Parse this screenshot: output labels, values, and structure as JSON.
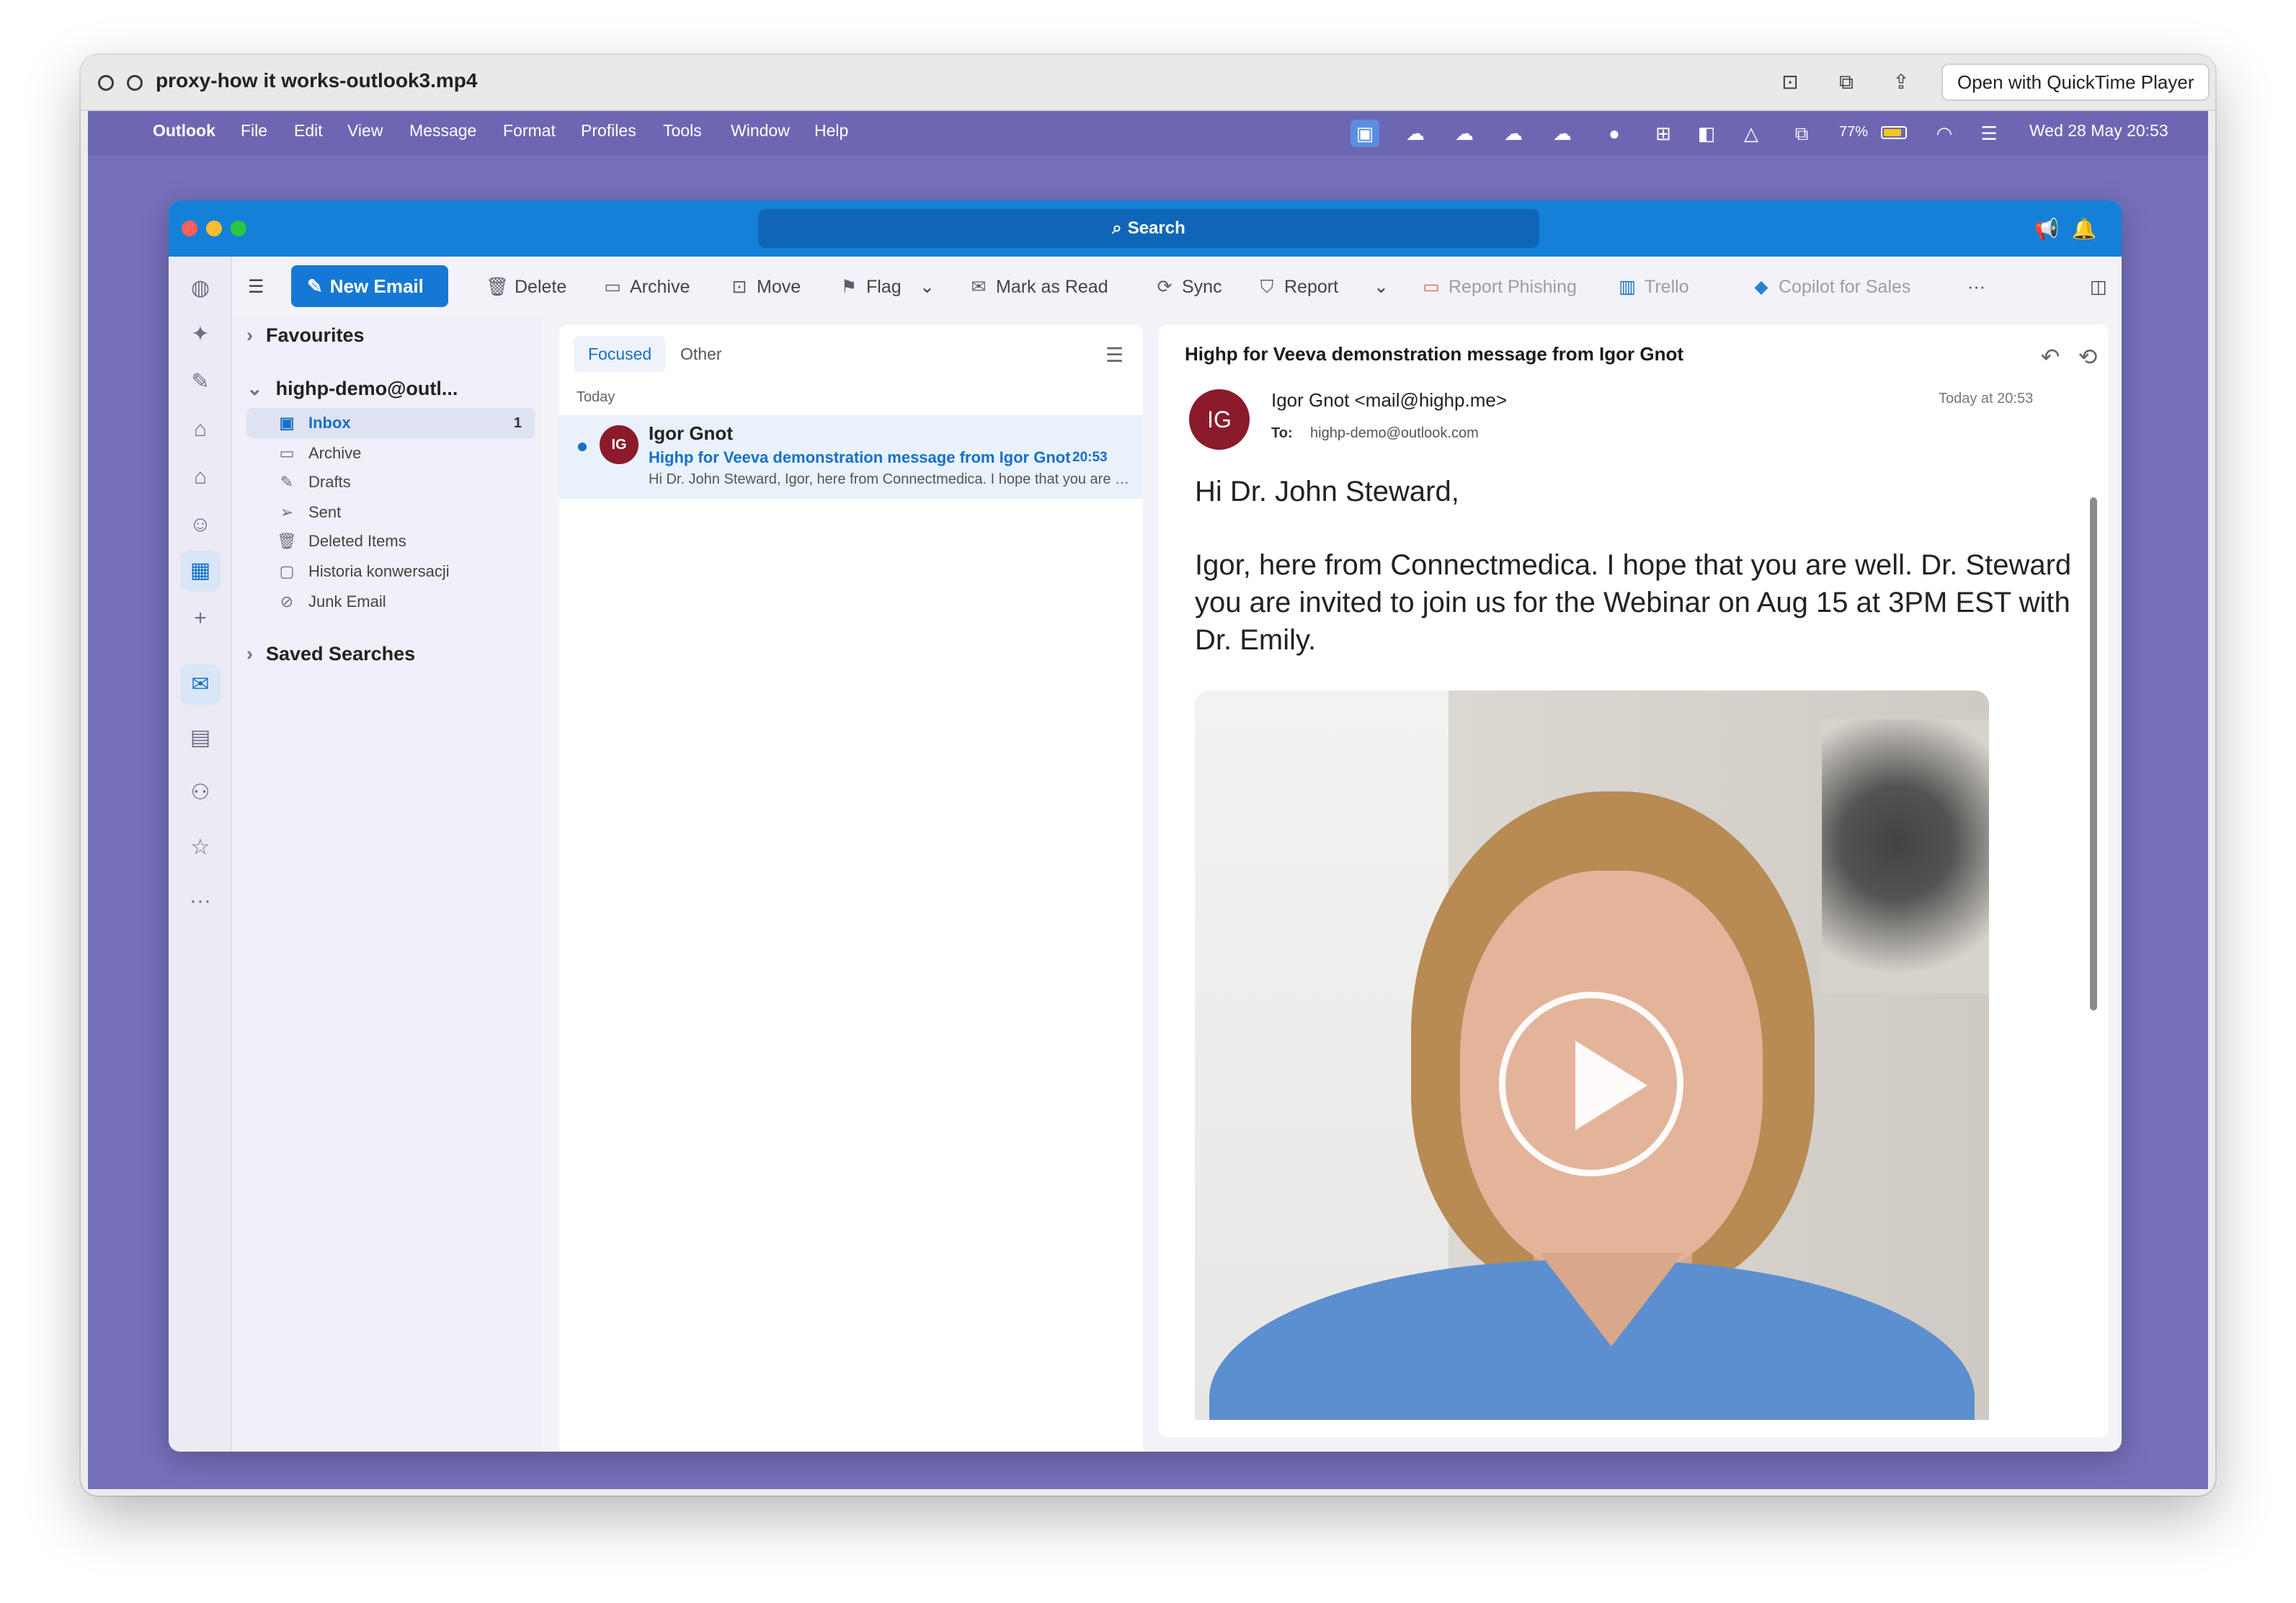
{
  "player": {
    "title": "proxy-how it works-outlook3.mp4",
    "open_with": "Open with QuickTime Player"
  },
  "menubar": {
    "app": "Outlook",
    "items": [
      "File",
      "Edit",
      "View",
      "Message",
      "Format",
      "Profiles",
      "Tools",
      "Window",
      "Help"
    ],
    "battery": "77%",
    "clock": "Wed 28 May  20:53"
  },
  "outlook": {
    "search": "Search",
    "toolbar": {
      "new_email": "New Email",
      "delete": "Delete",
      "archive": "Archive",
      "move": "Move",
      "flag": "Flag",
      "mark_as_read": "Mark as Read",
      "sync": "Sync",
      "report": "Report",
      "report_phishing": "Report Phishing",
      "trello": "Trello",
      "copilot": "Copilot for Sales",
      "more": "···"
    },
    "folders": {
      "favourites": "Favourites",
      "account": "highp-demo@outl...",
      "items": [
        {
          "label": "Inbox",
          "count": "1",
          "icon": "inbox-icon"
        },
        {
          "label": "Archive",
          "icon": "archive-icon"
        },
        {
          "label": "Drafts",
          "icon": "drafts-icon"
        },
        {
          "label": "Sent",
          "icon": "sent-icon"
        },
        {
          "label": "Deleted Items",
          "icon": "trash-icon"
        },
        {
          "label": "Historia konwersacji",
          "icon": "folder-icon"
        },
        {
          "label": "Junk Email",
          "icon": "junk-icon"
        }
      ],
      "saved_searches": "Saved Searches"
    },
    "list": {
      "tab_focused": "Focused",
      "tab_other": "Other",
      "group_today": "Today",
      "message": {
        "initials": "IG",
        "sender": "Igor Gnot",
        "subject": "Highp for Veeva demonstration message from Igor Gnot",
        "time": "20:53",
        "preview": "Hi Dr. John Steward, Igor, here from Connectmedica. I hope that you are well. Dr. Steward"
      }
    },
    "reading": {
      "subject": "Highp for Veeva demonstration message from Igor Gnot",
      "initials": "IG",
      "from": "Igor Gnot <mail@highp.me>",
      "to_label": "To:",
      "to": "highp-demo@outlook.com",
      "date": "Today at 20:53",
      "greeting": "Hi Dr. John Steward,",
      "body": "Igor, here from Connectmedica. I hope that you are well. Dr. Steward you are invited to join us for the Webinar on Aug 15 at 3PM EST with Dr. Emily."
    }
  },
  "colors": {
    "accent": "#1478d4",
    "title_bar": "#1480d8",
    "desktop": "#7670bb",
    "avatar": "#8b1a2a"
  }
}
